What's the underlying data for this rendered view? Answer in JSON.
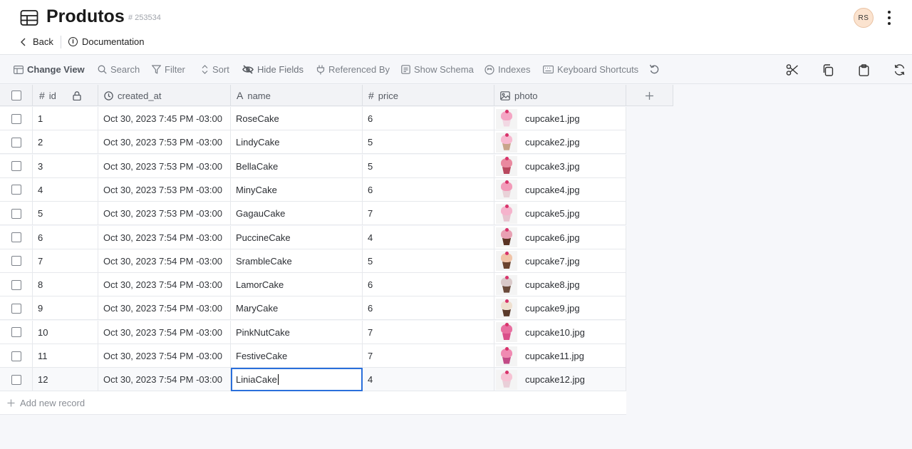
{
  "header": {
    "title": "Produtos",
    "table_id": "# 253534",
    "back_label": "Back",
    "documentation_label": "Documentation",
    "avatar_initials": "RS"
  },
  "toolbar": {
    "change_view": "Change View",
    "search": "Search",
    "filter": "Filter",
    "sort": "Sort",
    "hide_fields": "Hide Fields",
    "referenced_by": "Referenced By",
    "show_schema": "Show Schema",
    "indexes": "Indexes",
    "keyboard_shortcuts": "Keyboard Shortcuts"
  },
  "columns": {
    "id": "id",
    "created_at": "created_at",
    "name": "name",
    "price": "price",
    "photo": "photo"
  },
  "rows": [
    {
      "id": "1",
      "created_at": "Oct 30, 2023 7:45 PM -03:00",
      "name": "RoseCake",
      "price": "6",
      "photo": "cupcake1.jpg"
    },
    {
      "id": "2",
      "created_at": "Oct 30, 2023 7:53 PM -03:00",
      "name": "LindyCake",
      "price": "5",
      "photo": "cupcake2.jpg"
    },
    {
      "id": "3",
      "created_at": "Oct 30, 2023 7:53 PM -03:00",
      "name": "BellaCake",
      "price": "5",
      "photo": "cupcake3.jpg"
    },
    {
      "id": "4",
      "created_at": "Oct 30, 2023 7:53 PM -03:00",
      "name": "MinyCake",
      "price": "6",
      "photo": "cupcake4.jpg"
    },
    {
      "id": "5",
      "created_at": "Oct 30, 2023 7:53 PM -03:00",
      "name": "GagauCake",
      "price": "7",
      "photo": "cupcake5.jpg"
    },
    {
      "id": "6",
      "created_at": "Oct 30, 2023 7:54 PM -03:00",
      "name": "PuccineCake",
      "price": "4",
      "photo": "cupcake6.jpg"
    },
    {
      "id": "7",
      "created_at": "Oct 30, 2023 7:54 PM -03:00",
      "name": "SrambleCake",
      "price": "5",
      "photo": "cupcake7.jpg"
    },
    {
      "id": "8",
      "created_at": "Oct 30, 2023 7:54 PM -03:00",
      "name": "LamorCake",
      "price": "6",
      "photo": "cupcake8.jpg"
    },
    {
      "id": "9",
      "created_at": "Oct 30, 2023 7:54 PM -03:00",
      "name": "MaryCake",
      "price": "6",
      "photo": "cupcake9.jpg"
    },
    {
      "id": "10",
      "created_at": "Oct 30, 2023 7:54 PM -03:00",
      "name": "PinkNutCake",
      "price": "7",
      "photo": "cupcake10.jpg"
    },
    {
      "id": "11",
      "created_at": "Oct 30, 2023 7:54 PM -03:00",
      "name": "FestiveCake",
      "price": "7",
      "photo": "cupcake11.jpg"
    },
    {
      "id": "12",
      "created_at": "Oct 30, 2023 7:54 PM -03:00",
      "name": "LiniaCake",
      "price": "4",
      "photo": "cupcake12.jpg"
    }
  ],
  "add_record_label": "Add new record",
  "colors": {
    "selection_border": "#2a6fdb",
    "avatar_bg": "#fbe3cf"
  }
}
